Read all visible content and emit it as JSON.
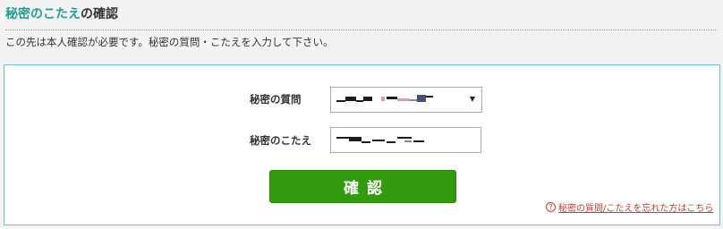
{
  "heading": {
    "accent_text": "秘密のこたえ",
    "rest_text": "の確認"
  },
  "intro_text": "この先は本人確認が必要です。秘密の質問・こたえを入力して下さい。",
  "form": {
    "question_label": "秘密の質問",
    "answer_label": "秘密のこたえ",
    "submit_label": "確認"
  },
  "forgot_link": {
    "icon": "help-circle-icon",
    "text": "秘密の質問/こたえを忘れた方はこちら"
  },
  "colors": {
    "accent": "#1d9f93",
    "panel_border": "#73bfc7",
    "button": "#339a0f",
    "link": "#c43c2c"
  }
}
